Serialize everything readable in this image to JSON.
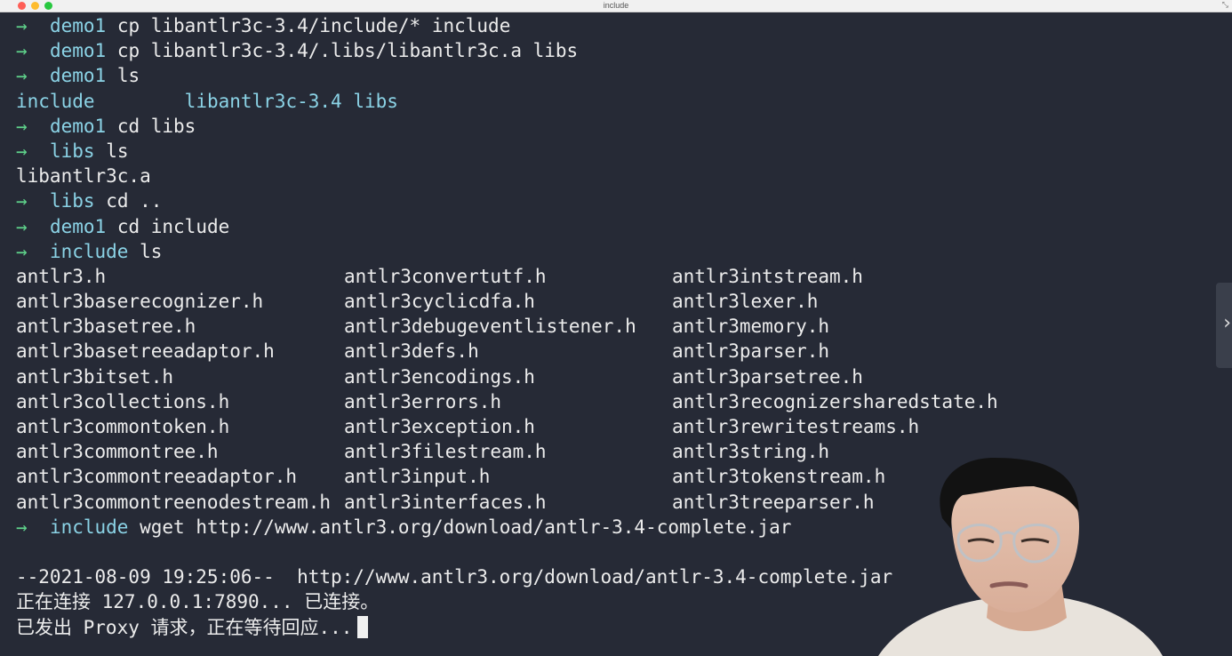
{
  "window": {
    "title": "include",
    "corner_icon": "resize-icon",
    "corner_glyph": "⤡"
  },
  "colors": {
    "background": "#262a36",
    "prompt_arrow": "#5fd38b",
    "directory": "#8bd3e6",
    "text": "#ececec"
  },
  "terminal": {
    "prompt_symbol": "→",
    "commands": [
      {
        "dir": "demo1",
        "cmd": "cp libantlr3c-3.4/include/* include"
      },
      {
        "dir": "demo1",
        "cmd": "cp libantlr3c-3.4/.libs/libantlr3c.a libs"
      },
      {
        "dir": "demo1",
        "cmd": "ls"
      }
    ],
    "ls_output_1": {
      "entries": [
        "include",
        "libantlr3c-3.4",
        "libs"
      ],
      "gaps": [
        "        ",
        " "
      ]
    },
    "commands_2": [
      {
        "dir": "demo1",
        "cmd": "cd libs"
      },
      {
        "dir": "libs",
        "cmd": "ls"
      }
    ],
    "ls_output_2": "libantlr3c.a",
    "commands_3": [
      {
        "dir": "libs",
        "cmd": "cd .."
      },
      {
        "dir": "demo1",
        "cmd": "cd include"
      },
      {
        "dir": "include",
        "cmd": "ls"
      }
    ],
    "files": [
      "antlr3.h",
      "antlr3convertutf.h",
      "antlr3intstream.h",
      "antlr3baserecognizer.h",
      "antlr3cyclicdfa.h",
      "antlr3lexer.h",
      "antlr3basetree.h",
      "antlr3debugeventlistener.h",
      "antlr3memory.h",
      "antlr3basetreeadaptor.h",
      "antlr3defs.h",
      "antlr3parser.h",
      "antlr3bitset.h",
      "antlr3encodings.h",
      "antlr3parsetree.h",
      "antlr3collections.h",
      "antlr3errors.h",
      "antlr3recognizersharedstate.h",
      "antlr3commontoken.h",
      "antlr3exception.h",
      "antlr3rewritestreams.h",
      "antlr3commontree.h",
      "antlr3filestream.h",
      "antlr3string.h",
      "antlr3commontreeadaptor.h",
      "antlr3input.h",
      "antlr3tokenstream.h",
      "antlr3commontreenodestream.h",
      "antlr3interfaces.h",
      "antlr3treeparser.h"
    ],
    "wget_command": {
      "dir": "include",
      "cmd": "wget http://www.antlr3.org/download/antlr-3.4-complete.jar"
    },
    "wget_output": [
      "",
      "--2021-08-09 19:25:06--  http://www.antlr3.org/download/antlr-3.4-complete.jar",
      "正在连接 127.0.0.1:7890... 已连接。",
      "已发出 Proxy 请求，正在等待回应..."
    ]
  },
  "side_panel": {
    "chevron_glyph": "›",
    "icon": "chevron-right-icon"
  },
  "webcam": {
    "description_icon": "presenter-webcam-overlay"
  }
}
